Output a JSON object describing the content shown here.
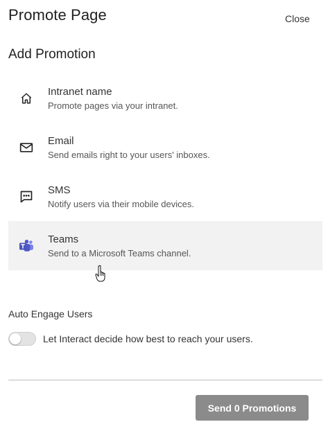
{
  "header": {
    "title": "Promote Page",
    "close_label": "Close"
  },
  "add_promotion": {
    "title": "Add Promotion",
    "items": [
      {
        "name": "Intranet name",
        "description": "Promote pages via your intranet.",
        "icon": "home-icon"
      },
      {
        "name": "Email",
        "description": "Send emails right to your users' inboxes.",
        "icon": "mail-icon"
      },
      {
        "name": "SMS",
        "description": "Notify users via their mobile devices.",
        "icon": "chat-icon"
      },
      {
        "name": "Teams",
        "description": "Send to a Microsoft Teams channel.",
        "icon": "teams-icon"
      }
    ]
  },
  "auto_engage": {
    "label": "Auto Engage Users",
    "toggle_label": "Let Interact decide how best to reach your users.",
    "enabled": false
  },
  "footer": {
    "send_label": "Send 0 Promotions"
  },
  "colors": {
    "hover_bg": "#f2f2f2",
    "teams_purple": "#5059c9",
    "button_bg": "#8b8b8b"
  }
}
